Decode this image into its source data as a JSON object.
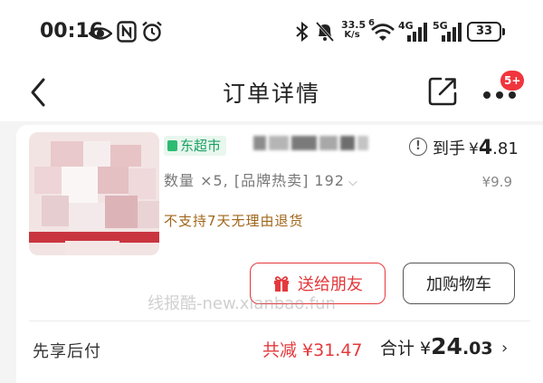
{
  "status_bar": {
    "time": "00:16",
    "net_speed_value": "33.5",
    "net_speed_unit": "K/s",
    "wifi_label": "6",
    "cell1_label": "4G",
    "cell2_label": "5G",
    "battery": "33"
  },
  "nav": {
    "title": "订单详情",
    "badge": "5+"
  },
  "product": {
    "shop_tag": "东超市",
    "quantity_text": "数量 ×5, [品牌热卖] 192",
    "return_note": "不支持7天无理由退货",
    "final_price_prefix": "到手",
    "final_price_yen": "¥",
    "final_price_int": "4",
    "final_price_dec": ".81",
    "original_price": "¥9.9"
  },
  "actions": {
    "gift_label": "送给朋友",
    "cart_label": "加购物车"
  },
  "watermark": "线报酷-new.xianbao.fun",
  "summary": {
    "pay_later": "先享后付",
    "reduce_text": "共减 ¥31.47",
    "total_prefix": "合计 ¥",
    "total_int": "24",
    "total_dec": ".03"
  },
  "colors": {
    "accent": "#e4393c",
    "shop_green": "#1aa062",
    "return_note": "#a0661a",
    "badge": "#f0353d"
  }
}
